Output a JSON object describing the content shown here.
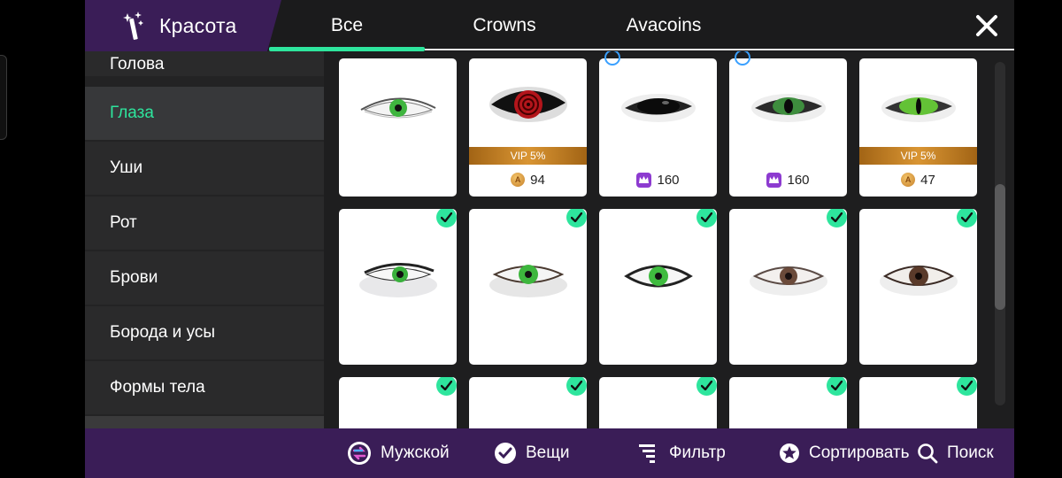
{
  "header": {
    "section_title": "Красота",
    "tabs": [
      {
        "label": "Все",
        "active": true
      },
      {
        "label": "Crowns",
        "active": false
      },
      {
        "label": "Avacoins",
        "active": false
      }
    ]
  },
  "sidebar": {
    "items": [
      {
        "label": "Голова",
        "active": false
      },
      {
        "label": "Глаза",
        "active": true
      },
      {
        "label": "Уши",
        "active": false
      },
      {
        "label": "Рот",
        "active": false
      },
      {
        "label": "Брови",
        "active": false
      },
      {
        "label": "Борода и усы",
        "active": false
      },
      {
        "label": "Формы тела",
        "active": false
      }
    ]
  },
  "grid": {
    "row1": [
      {
        "name": "green-eye",
        "vip": "",
        "price": "",
        "currency": ""
      },
      {
        "name": "red-spiral-eye",
        "vip": "VIP 5%",
        "price": "94",
        "currency": "avacoins"
      },
      {
        "name": "black-eye",
        "vip": "",
        "price": "160",
        "currency": "crowns"
      },
      {
        "name": "green-dark-eye",
        "vip": "",
        "price": "160",
        "currency": "crowns"
      },
      {
        "name": "green-cat-eye",
        "vip": "VIP 5%",
        "price": "47",
        "currency": "avacoins"
      }
    ],
    "row2": [
      {
        "name": "green-eye-shaded",
        "owned": true
      },
      {
        "name": "green-eye-soft",
        "owned": true
      },
      {
        "name": "green-eye-outlined",
        "owned": true
      },
      {
        "name": "brown-eye-light",
        "owned": true
      },
      {
        "name": "brown-eye-dark",
        "owned": true
      }
    ],
    "row3_owned": [
      true,
      true,
      true,
      true,
      true
    ]
  },
  "footer": {
    "gender": "Мужской",
    "items": "Вещи",
    "filter": "Фильтр",
    "sort": "Сортировать",
    "search": "Поиск"
  },
  "colors": {
    "accent": "#2ee59d",
    "purple": "#3a1d57",
    "vip_gold": "#d99533"
  }
}
